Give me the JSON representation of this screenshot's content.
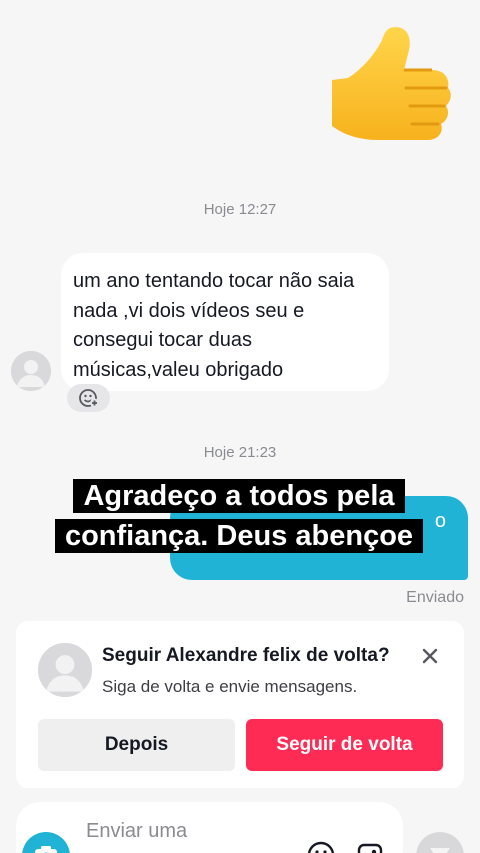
{
  "chat": {
    "timestamp_1": "Hoje 12:27",
    "timestamp_2": "Hoje 21:23",
    "incoming_message": "um ano tentando tocar não saia nada ,vi dois vídeos seu e consegui tocar duas músicas,valeu obrigado",
    "outgoing_partial": "o",
    "caption": "Agradeço a todos pela confiança. Deus abençoe",
    "sent_status": "Enviado",
    "sent_emoji": "thumbs-up"
  },
  "follow_card": {
    "title": "Seguir Alexandre felix de volta?",
    "subtitle": "Siga de volta e envie mensagens.",
    "later_label": "Depois",
    "follow_label": "Seguir de volta"
  },
  "composer": {
    "placeholder": "Enviar uma"
  },
  "colors": {
    "accent_blue": "#20b3d6",
    "follow_red": "#fe2c55"
  }
}
